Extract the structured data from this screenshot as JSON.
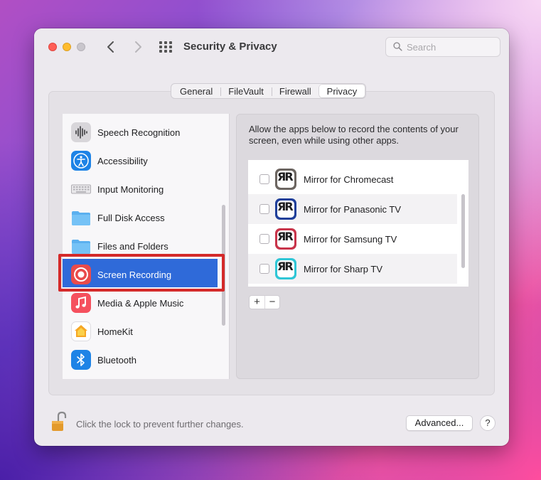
{
  "window": {
    "title": "Security & Privacy"
  },
  "search": {
    "placeholder": "Search"
  },
  "tabs": [
    {
      "label": "General"
    },
    {
      "label": "FileVault"
    },
    {
      "label": "Firewall"
    },
    {
      "label": "Privacy",
      "active": true
    }
  ],
  "sidebar": {
    "items": [
      {
        "label": "Speech Recognition",
        "icon": "waveform-icon"
      },
      {
        "label": "Accessibility",
        "icon": "accessibility-icon"
      },
      {
        "label": "Input Monitoring",
        "icon": "keyboard-icon"
      },
      {
        "label": "Full Disk Access",
        "icon": "folder-icon"
      },
      {
        "label": "Files and Folders",
        "icon": "folder-icon"
      },
      {
        "label": "Screen Recording",
        "icon": "record-icon",
        "selected": true
      },
      {
        "label": "Media & Apple Music",
        "icon": "music-note-icon"
      },
      {
        "label": "HomeKit",
        "icon": "home-icon"
      },
      {
        "label": "Bluetooth",
        "icon": "bluetooth-icon"
      }
    ]
  },
  "panel": {
    "description": "Allow the apps below to record the contents of your screen, even while using other apps.",
    "apps": [
      {
        "name": "Mirror for Chromecast",
        "checked": false,
        "icon_color": "#6b6560"
      },
      {
        "name": "Mirror for Panasonic TV",
        "checked": false,
        "icon_color": "#1f3f9a"
      },
      {
        "name": "Mirror for Samsung TV",
        "checked": false,
        "icon_color": "#c8344a"
      },
      {
        "name": "Mirror for Sharp TV",
        "checked": false,
        "icon_color": "#2fc6d6"
      }
    ],
    "add_label": "+",
    "remove_label": "−"
  },
  "footer": {
    "lock_text": "Click the lock to prevent further changes.",
    "advanced_label": "Advanced...",
    "help_label": "?"
  },
  "colors": {
    "selection": "#2f6ad9",
    "highlight_outline": "#d42a2a"
  }
}
